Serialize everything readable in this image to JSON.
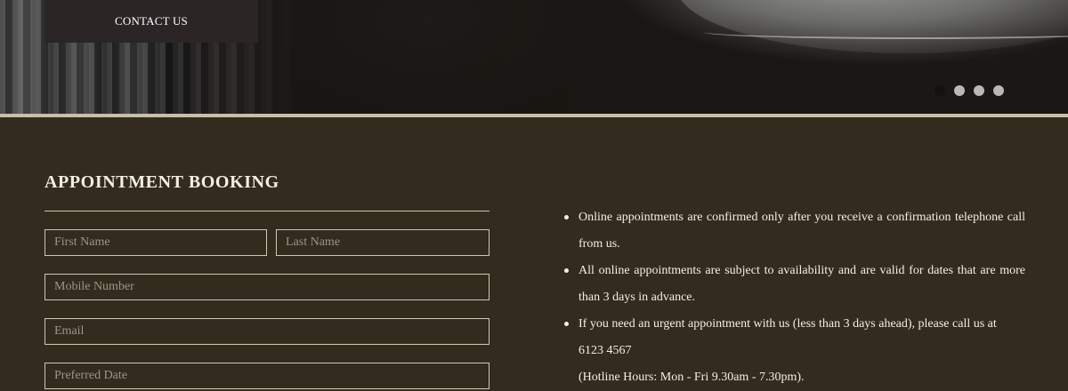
{
  "hero": {
    "contact_label": "CONTACT US",
    "slide_dots": [
      {
        "active": true
      },
      {
        "active": false
      },
      {
        "active": false
      },
      {
        "active": false
      }
    ]
  },
  "booking": {
    "title": "APPOINTMENT BOOKING",
    "fields": {
      "first_name": {
        "placeholder": "First Name",
        "value": ""
      },
      "last_name": {
        "placeholder": "Last Name",
        "value": ""
      },
      "mobile": {
        "placeholder": "Mobile Number",
        "value": ""
      },
      "email": {
        "placeholder": "Email",
        "value": ""
      },
      "preferred_date": {
        "placeholder": "Preferred Date",
        "value": ""
      }
    }
  },
  "notes": {
    "items": [
      {
        "text": "Online appointments are confirmed only after you receive a confirmation telephone call from us."
      },
      {
        "text": "All online appointments are subject to availability and are valid for dates that are more than 3 days in advance."
      },
      {
        "text": "If you need an urgent appointment with us (less than 3 days ahead), please call us at",
        "phone": "6123 4567",
        "hours": "(Hotline Hours: Mon - Fri 9.30am - 7.30pm)."
      }
    ]
  },
  "colors": {
    "section_bg": "#332b1d",
    "divider": "#c7bfa9",
    "contact_bg": "#2b2526",
    "text": "#f3efe6"
  }
}
